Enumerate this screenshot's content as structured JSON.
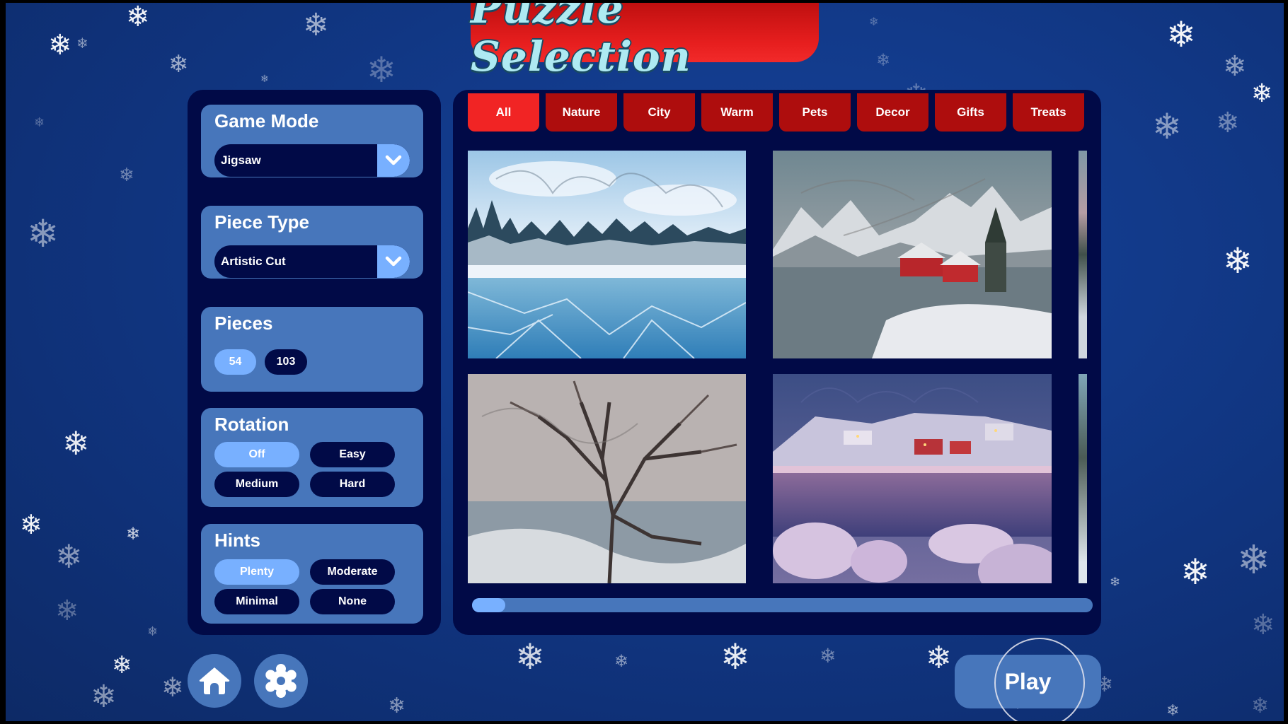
{
  "title": "Puzzle Selection",
  "settings": {
    "game_mode": {
      "label": "Game Mode",
      "value": "Jigsaw"
    },
    "piece_type": {
      "label": "Piece Type",
      "value": "Artistic Cut"
    },
    "pieces": {
      "label": "Pieces",
      "options": [
        "54",
        "103"
      ],
      "selected": "54"
    },
    "rotation": {
      "label": "Rotation",
      "options": [
        "Off",
        "Easy",
        "Medium",
        "Hard"
      ],
      "selected": "Off"
    },
    "hints": {
      "label": "Hints",
      "options": [
        "Plenty",
        "Moderate",
        "Minimal",
        "None"
      ],
      "selected": "Plenty"
    }
  },
  "categories": {
    "tabs": [
      "All",
      "Nature",
      "City",
      "Warm",
      "Pets",
      "Decor",
      "Gifts",
      "Treats"
    ],
    "selected": "All"
  },
  "puzzles": [
    {
      "name": "Frozen lake with snowy forest"
    },
    {
      "name": "Snowy fishing village with red cabins"
    },
    {
      "name": "Frosted tree by winter stream"
    },
    {
      "name": "Twilight village over reflective bay"
    }
  ],
  "gallery_scroll": {
    "position_fraction": 0.0
  },
  "buttons": {
    "home": "home",
    "settings": "settings",
    "play": "Play"
  },
  "colors": {
    "panel": "#010a47",
    "card": "#4776bb",
    "selected": "#78b0ff",
    "tab": "#ae0d0d",
    "tab_active": "#f12424",
    "title_text": "#aeeaf2"
  }
}
